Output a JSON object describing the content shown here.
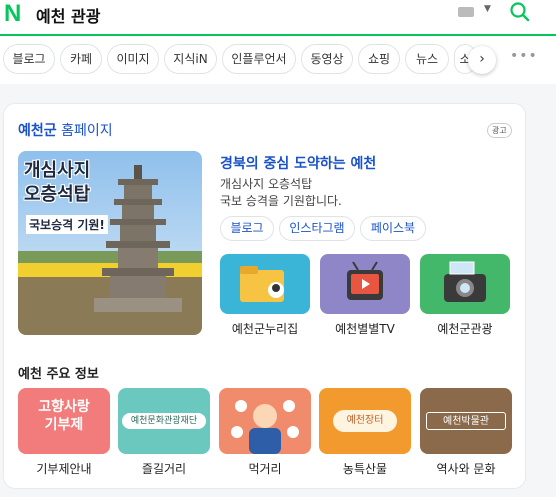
{
  "header": {
    "logo": "N",
    "query": "예천 관광"
  },
  "tabs": [
    "블로그",
    "카페",
    "이미지",
    "지식iN",
    "인플루언서",
    "동영상",
    "쇼핑",
    "뉴스",
    "소"
  ],
  "card": {
    "title_bold": "예천군",
    "title_rest": " 홈페이지",
    "ad_label": "광고",
    "banner": {
      "line1": "개심사지",
      "line2": "오층석탑",
      "line3": "국보승격 기원!"
    },
    "headline": "경북의 중심 도약하는 예천",
    "desc_line1": "개심사지 오층석탑",
    "desc_line2": "국보 승격을 기원합니다.",
    "links": [
      "블로그",
      "인스타그램",
      "페이스북"
    ],
    "thumbs": [
      "예천군누리집",
      "예천별별TV",
      "예천군관광"
    ]
  },
  "info": {
    "title": "예천 주요 정보",
    "tiles": [
      {
        "label": "기부제안내",
        "art_line1": "고향사랑",
        "art_line2": "기부제"
      },
      {
        "label": "즐길거리",
        "art_text": "예천문화관광재단"
      },
      {
        "label": "먹거리"
      },
      {
        "label": "농특산물",
        "art_text": "예천장터"
      },
      {
        "label": "역사와 문화",
        "art_text": "예천박물관"
      }
    ]
  },
  "colors": {
    "brand": "#03c75a",
    "link": "#1a52c9"
  }
}
